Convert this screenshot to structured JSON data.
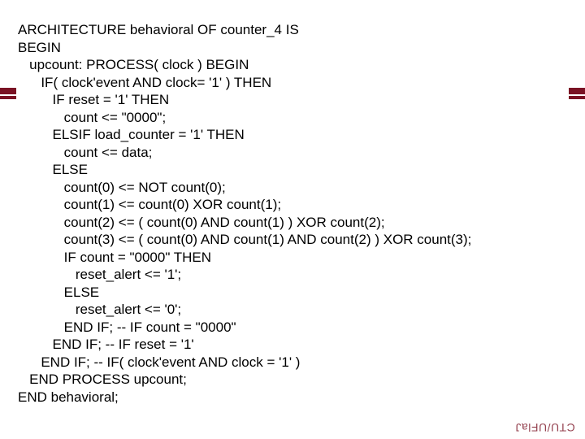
{
  "code": {
    "l01": "ARCHITECTURE behavioral OF counter_4 IS",
    "l02": "BEGIN",
    "l03": "   upcount: PROCESS( clock ) BEGIN",
    "l04": "      IF( clock'event AND clock= '1' ) THEN",
    "l05": "         IF reset = '1' THEN",
    "l06": "            count <= \"0000\";",
    "l07": "         ELSIF load_counter = '1' THEN",
    "l08": "            count <= data;",
    "l09": "         ELSE",
    "l10": "            count(0) <= NOT count(0);",
    "l11": "            count(1) <= count(0) XOR count(1);",
    "l12": "            count(2) <= ( count(0) AND count(1) ) XOR count(2);",
    "l13": "            count(3) <= ( count(0) AND count(1) AND count(2) ) XOR count(3);",
    "l14": "            IF count = \"0000\" THEN",
    "l15": "               reset_alert <= '1';",
    "l16": "            ELSE",
    "l17": "               reset_alert <= '0';",
    "l18": "            END IF; -- IF count = \"0000\"",
    "l19": "         END IF; -- IF reset = '1'",
    "l20": "      END IF; -- IF( clock'event AND clock = '1' )",
    "l21": "   END PROCESS upcount;",
    "l22": "END behavioral;"
  },
  "footer": "CTU/UFlaJ"
}
